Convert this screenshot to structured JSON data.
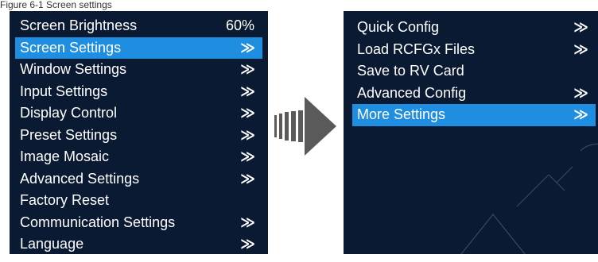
{
  "caption": "Figure 6-1 Screen settings",
  "left_menu": {
    "items": [
      {
        "label": "Screen Brightness",
        "value": "60%",
        "chevron": "",
        "selected": false
      },
      {
        "label": "Screen Settings",
        "value": "",
        "chevron": "≫",
        "selected": true
      },
      {
        "label": "Window Settings",
        "value": "",
        "chevron": "≫",
        "selected": false
      },
      {
        "label": "Input Settings",
        "value": "",
        "chevron": "≫",
        "selected": false
      },
      {
        "label": "Display Control",
        "value": "",
        "chevron": "≫",
        "selected": false
      },
      {
        "label": "Preset Settings",
        "value": "",
        "chevron": "≫",
        "selected": false
      },
      {
        "label": "Image Mosaic",
        "value": "",
        "chevron": "≫",
        "selected": false
      },
      {
        "label": "Advanced Settings",
        "value": "",
        "chevron": "≫",
        "selected": false
      },
      {
        "label": "Factory Reset",
        "value": "",
        "chevron": "",
        "selected": false
      },
      {
        "label": "Communication Settings",
        "value": "",
        "chevron": "≫",
        "selected": false
      },
      {
        "label": "Language",
        "value": "",
        "chevron": "≫",
        "selected": false
      }
    ]
  },
  "right_menu": {
    "items": [
      {
        "label": "Quick Config",
        "chevron": "≫",
        "selected": false
      },
      {
        "label": "Load RCFGx Files",
        "chevron": "≫",
        "selected": false
      },
      {
        "label": "Save to RV Card",
        "chevron": "",
        "selected": false
      },
      {
        "label": "Advanced Config",
        "chevron": "≫",
        "selected": false
      },
      {
        "label": "More Settings",
        "chevron": "≫",
        "selected": true
      }
    ]
  },
  "icons": {
    "transition": "right-arrow-icon",
    "submenu": "double-chevron-right-icon"
  },
  "colors": {
    "panel_bg": "#0b1a33",
    "highlight": "#1f8ee0",
    "text": "#ffffff",
    "arrow": "#5a5a5a"
  }
}
